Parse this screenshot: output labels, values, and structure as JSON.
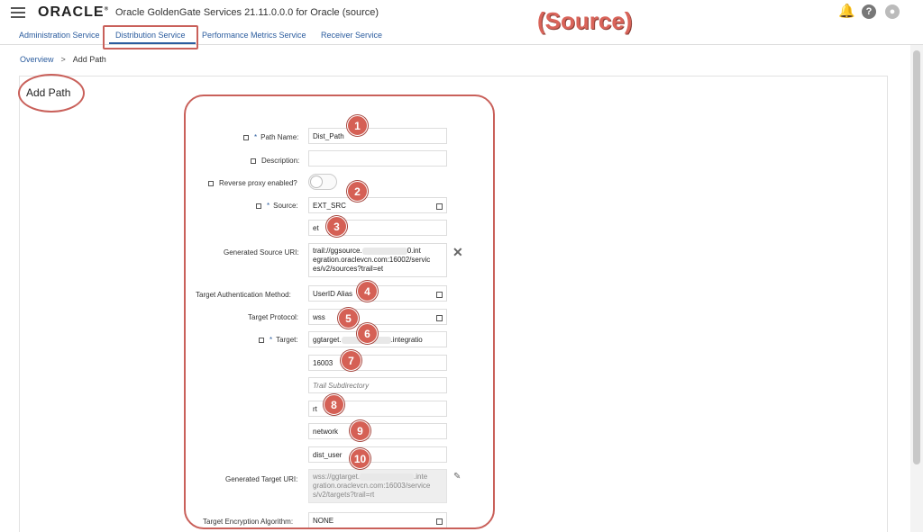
{
  "header": {
    "logo": "ORACLE",
    "logo_mark": "®",
    "app_title": "Oracle GoldenGate Services 21.11.0.0.0 for Oracle (source)",
    "annotation": "(Source)",
    "icons": [
      "bell-icon",
      "help-icon",
      "user-avatar-icon"
    ],
    "help_glyph": "?"
  },
  "tabs": [
    {
      "label": "Administration Service"
    },
    {
      "label": "Distribution Service",
      "active": true
    },
    {
      "label": "Performance Metrics Service"
    },
    {
      "label": "Receiver Service"
    }
  ],
  "breadcrumb": {
    "parent": "Overview",
    "separator": ">",
    "current": "Add Path"
  },
  "page_title": "Add Path",
  "form": {
    "path_name_label": "Path Name:",
    "path_name_value": "Dist_Path",
    "description_label": "Description:",
    "description_value": "",
    "reverse_proxy_label": "Reverse proxy enabled?",
    "reverse_proxy_on": false,
    "source_label": "Source:",
    "source_value": "EXT_SRC",
    "source_trail_value": "et",
    "gen_source_uri_label": "Generated Source URI:",
    "gen_source_uri_part1": "trail://ggsource.",
    "gen_source_uri_part2": "0.int egration.oraclevcn.com:16002/servic es/v2/sources?trail=et",
    "target_auth_label": "Target Authentication Method:",
    "target_auth_value": "UserID Alias",
    "target_protocol_label": "Target Protocol:",
    "target_protocol_value": "wss",
    "target_label": "Target:",
    "target_host_part1": "ggtarget.",
    "target_host_part2": ".integratio",
    "target_port_value": "16003",
    "trail_subdir_placeholder": "Trail Subdirectory",
    "target_trail_value": "rt",
    "domain_value": "network",
    "alias_value": "dist_user",
    "gen_target_uri_label": "Generated Target URI:",
    "gen_target_uri_part1": "wss://ggtarget.",
    "gen_target_uri_part2": ".inte gration.oraclevcn.com:16003/service s/v2/targets?trail=rt",
    "encryption_label": "Target Encryption Algorithm:",
    "encryption_value": "NONE",
    "required_mark": "*"
  },
  "badges": [
    "1",
    "2",
    "3",
    "4",
    "5",
    "6",
    "7",
    "8",
    "9",
    "10"
  ],
  "colors": {
    "accent": "#2b5c9e",
    "annotation": "#d56055"
  }
}
